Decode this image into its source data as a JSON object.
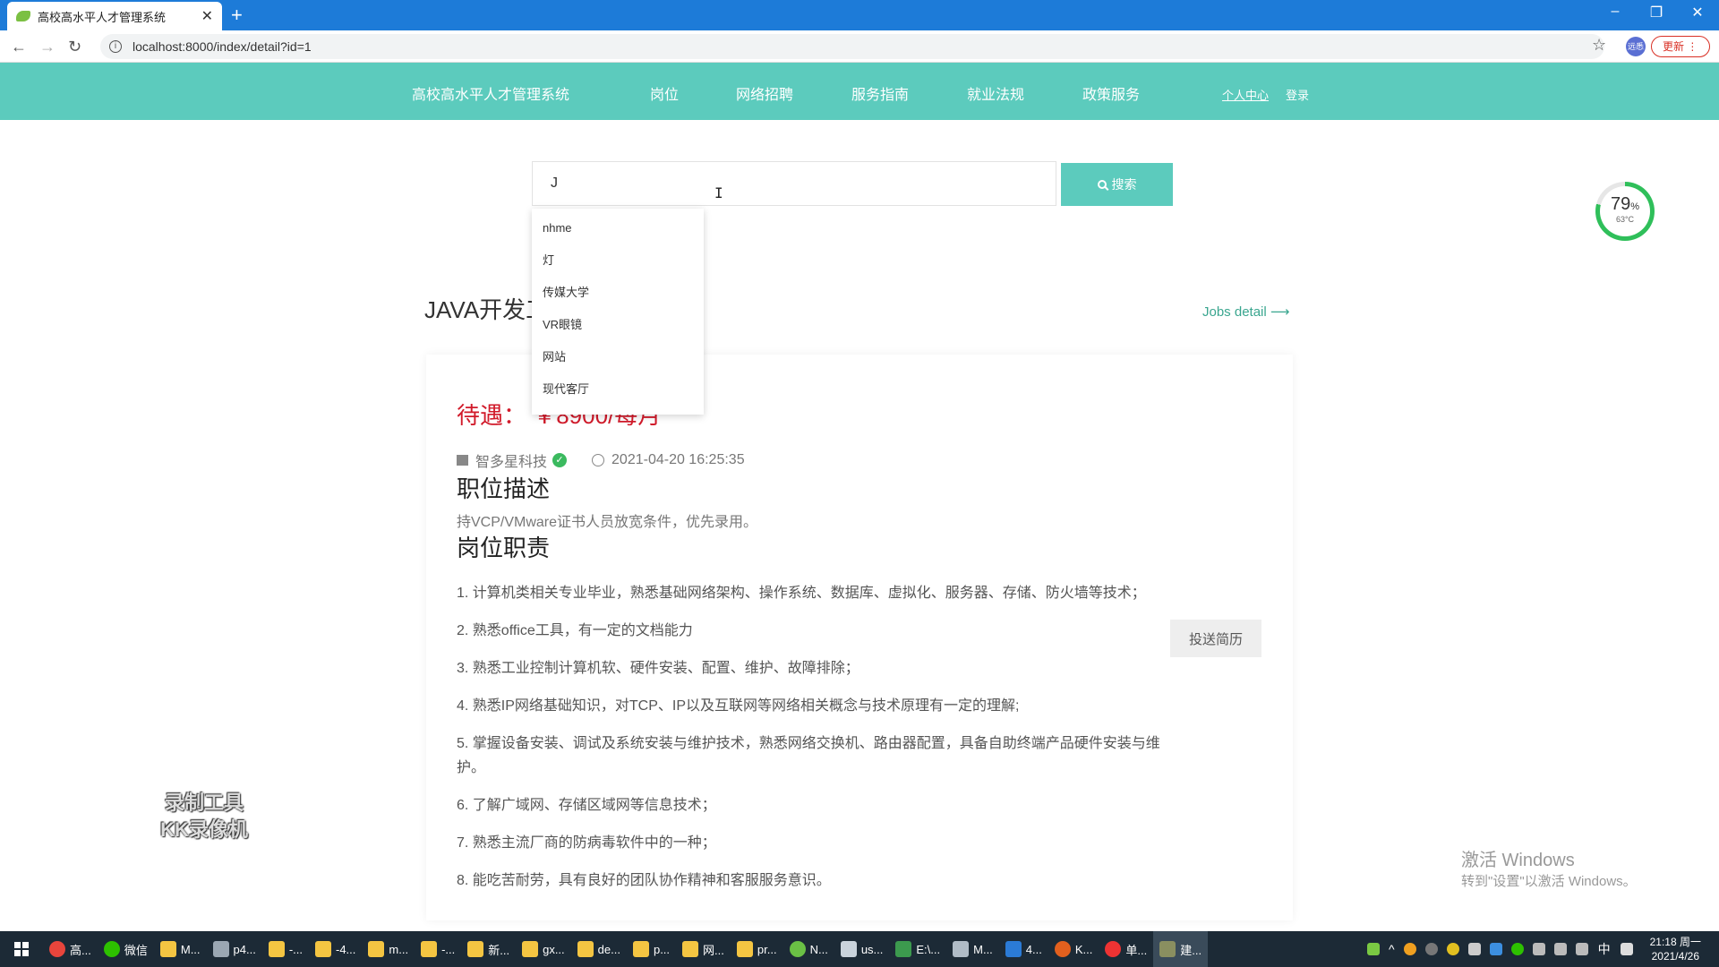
{
  "browser": {
    "tab_title": "高校高水平人才管理系统",
    "url": "localhost:8000/index/detail?id=1",
    "profile_label": "远悉",
    "update_label": "更新"
  },
  "nav": {
    "brand": "高校高水平人才管理系统",
    "items": [
      "岗位",
      "网络招聘",
      "服务指南",
      "就业法规",
      "政策服务"
    ],
    "personal_center": "个人中心",
    "login": "登录"
  },
  "search": {
    "value": "J",
    "button_label": "搜索",
    "suggestions": [
      "nhme",
      "灯",
      "传媒大学",
      "VR眼镜",
      "网站",
      "现代客厅"
    ]
  },
  "job": {
    "title": "JAVA开发工程师",
    "jobs_detail_link": "Jobs detail",
    "salary": "待遇：  ￥8900/每月",
    "company": "智多星科技",
    "posted_at": "2021-04-20 16:25:35",
    "description_heading": "职位描述",
    "description": "持VCP/VMware证书人员放宽条件，优先录用。",
    "duties_heading": "岗位职责",
    "duties": [
      "1. 计算机类相关专业毕业，熟悉基础网络架构、操作系统、数据库、虚拟化、服务器、存储、防火墙等技术；",
      "2. 熟悉office工具，有一定的文档能力",
      "3. 熟悉工业控制计算机软、硬件安装、配置、维护、故障排除；",
      "4. 熟悉IP网络基础知识，对TCP、IP以及互联网等网络相关概念与技术原理有一定的理解;",
      "5. 掌握设备安装、调试及系统安装与维护技术，熟悉网络交换机、路由器配置，具备自助终端产品硬件安装与维护。",
      "6. 了解广域网、存储区域网等信息技术；",
      "7. 熟悉主流厂商的防病毒软件中的一种；",
      "8. 能吃苦耐劳，具有良好的团队协作精神和客服服务意识。"
    ],
    "apply_label": "投送简历"
  },
  "overlay": {
    "gauge_percent": "79",
    "gauge_percent_sign": "%",
    "gauge_temp": "63°C",
    "watermark_line1": "录制工具",
    "watermark_line2": "KK录像机",
    "activate_title": "激活 Windows",
    "activate_sub": "转到\"设置\"以激活 Windows。"
  },
  "taskbar": {
    "items": [
      "高...",
      "微信",
      "M...",
      "p4...",
      "-...",
      "-4...",
      "m...",
      "-...",
      "新...",
      "gx...",
      "de...",
      "p...",
      "网...",
      "pr...",
      "N...",
      "us...",
      "E:\\...",
      "M...",
      "4...",
      "K...",
      "单...",
      "建..."
    ],
    "ime": "中",
    "time": "21:18 周一",
    "date": "2021/4/26"
  },
  "colors": {
    "accent": "#5ccbbd",
    "salary": "#d11a2a",
    "link": "#3aa68f"
  }
}
